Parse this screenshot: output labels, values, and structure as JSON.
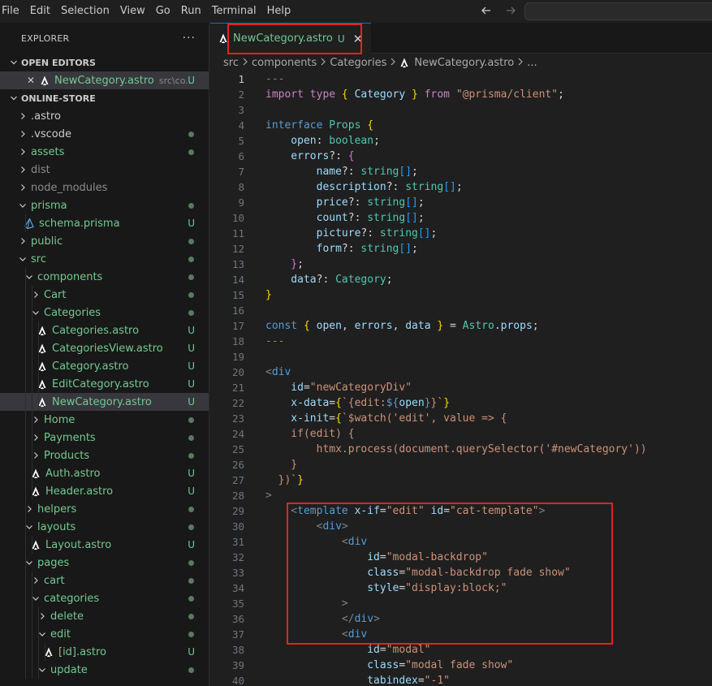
{
  "menu": [
    "File",
    "Edit",
    "Selection",
    "View",
    "Go",
    "Run",
    "Terminal",
    "Help"
  ],
  "explorer": {
    "title": "EXPLORER",
    "more": "···",
    "open_editors_label": "OPEN EDITORS",
    "open_editor": {
      "name": "NewCategory.astro",
      "path": "src\\co...",
      "badge": "U"
    },
    "project_label": "ONLINE-STORE",
    "tree": [
      {
        "label": ".astro",
        "depth": 0,
        "kind": "folder-closed",
        "color": "normal",
        "status": ""
      },
      {
        "label": ".vscode",
        "depth": 0,
        "kind": "folder-closed",
        "color": "normal",
        "status": "dot"
      },
      {
        "label": "assets",
        "depth": 0,
        "kind": "folder-closed",
        "color": "git",
        "status": "dot"
      },
      {
        "label": "dist",
        "depth": 0,
        "kind": "folder-closed",
        "color": "dim",
        "status": ""
      },
      {
        "label": "node_modules",
        "depth": 0,
        "kind": "folder-closed",
        "color": "dim",
        "status": ""
      },
      {
        "label": "prisma",
        "depth": 0,
        "kind": "folder-open",
        "color": "git",
        "status": "dot"
      },
      {
        "label": "schema.prisma",
        "depth": 1,
        "kind": "prisma",
        "color": "git",
        "status": "U"
      },
      {
        "label": "public",
        "depth": 0,
        "kind": "folder-closed",
        "color": "git",
        "status": "dot"
      },
      {
        "label": "src",
        "depth": 0,
        "kind": "folder-open",
        "color": "git",
        "status": "dot"
      },
      {
        "label": "components",
        "depth": 1,
        "kind": "folder-open",
        "color": "git",
        "status": "dot"
      },
      {
        "label": "Cart",
        "depth": 2,
        "kind": "folder-closed",
        "color": "git",
        "status": "dot"
      },
      {
        "label": "Categories",
        "depth": 2,
        "kind": "folder-open",
        "color": "git",
        "status": "dot"
      },
      {
        "label": "Categories.astro",
        "depth": 3,
        "kind": "astro",
        "color": "git",
        "status": "U"
      },
      {
        "label": "CategoriesView.astro",
        "depth": 3,
        "kind": "astro",
        "color": "git",
        "status": "U"
      },
      {
        "label": "Category.astro",
        "depth": 3,
        "kind": "astro",
        "color": "git",
        "status": "U"
      },
      {
        "label": "EditCategory.astro",
        "depth": 3,
        "kind": "astro",
        "color": "git",
        "status": "U"
      },
      {
        "label": "NewCategory.astro",
        "depth": 3,
        "kind": "astro",
        "color": "git",
        "status": "U",
        "selected": true
      },
      {
        "label": "Home",
        "depth": 2,
        "kind": "folder-closed",
        "color": "git",
        "status": "dot"
      },
      {
        "label": "Payments",
        "depth": 2,
        "kind": "folder-closed",
        "color": "git",
        "status": "dot"
      },
      {
        "label": "Products",
        "depth": 2,
        "kind": "folder-closed",
        "color": "git",
        "status": "dot"
      },
      {
        "label": "Auth.astro",
        "depth": 2,
        "kind": "astro",
        "color": "git",
        "status": "U"
      },
      {
        "label": "Header.astro",
        "depth": 2,
        "kind": "astro",
        "color": "git",
        "status": "U"
      },
      {
        "label": "helpers",
        "depth": 1,
        "kind": "folder-closed",
        "color": "git",
        "status": "dot"
      },
      {
        "label": "layouts",
        "depth": 1,
        "kind": "folder-open",
        "color": "git",
        "status": "dot"
      },
      {
        "label": "Layout.astro",
        "depth": 2,
        "kind": "astro",
        "color": "git",
        "status": "U"
      },
      {
        "label": "pages",
        "depth": 1,
        "kind": "folder-open",
        "color": "git",
        "status": "dot"
      },
      {
        "label": "cart",
        "depth": 2,
        "kind": "folder-closed",
        "color": "git",
        "status": "dot"
      },
      {
        "label": "categories",
        "depth": 2,
        "kind": "folder-open",
        "color": "git",
        "status": "dot"
      },
      {
        "label": "delete",
        "depth": 3,
        "kind": "folder-closed",
        "color": "git",
        "status": "dot"
      },
      {
        "label": "edit",
        "depth": 3,
        "kind": "folder-open",
        "color": "git",
        "status": "dot"
      },
      {
        "label": "[id].astro",
        "depth": 4,
        "kind": "astro",
        "color": "git",
        "status": "U"
      },
      {
        "label": "update",
        "depth": 3,
        "kind": "folder-open",
        "color": "git",
        "status": "dot"
      }
    ]
  },
  "tab": {
    "name": "NewCategory.astro",
    "badge": "U"
  },
  "breadcrumb": [
    "src",
    "components",
    "Categories",
    "NewCategory.astro",
    "..."
  ],
  "colors": {
    "keyword": "#569cd6",
    "control": "#c586c0",
    "string": "#ce9178",
    "type": "#4ec9b0",
    "variable": "#9cdcfe",
    "function": "#dcdcaa",
    "text": "#d4d4d4",
    "bracket1": "#ffd700",
    "bracket2": "#da70d6",
    "bracket3": "#179fff",
    "tag": "#808080",
    "comment": "#6a9955",
    "highlight_box": "#e02424",
    "git": "#73c991"
  },
  "code": [
    {
      "n": "1",
      "t": [
        [
          "---",
          "comment"
        ]
      ]
    },
    {
      "n": "2",
      "t": [
        [
          "import type ",
          "control"
        ],
        [
          "{ ",
          "bracket1"
        ],
        [
          "Category",
          "variable"
        ],
        [
          " } ",
          "bracket1"
        ],
        [
          "from ",
          "control"
        ],
        [
          "\"@prisma/client\"",
          "string"
        ],
        [
          ";",
          "text"
        ]
      ]
    },
    {
      "n": "3",
      "t": []
    },
    {
      "n": "4",
      "t": [
        [
          "interface ",
          "keyword"
        ],
        [
          "Props ",
          "type"
        ],
        [
          "{",
          "bracket1"
        ]
      ]
    },
    {
      "n": "5",
      "t": [
        [
          "    open",
          "variable"
        ],
        [
          ": ",
          "text"
        ],
        [
          "boolean",
          "type"
        ],
        [
          ";",
          "text"
        ]
      ]
    },
    {
      "n": "6",
      "t": [
        [
          "    errors",
          "variable"
        ],
        [
          "?: ",
          "text"
        ],
        [
          "{",
          "bracket2"
        ]
      ]
    },
    {
      "n": "7",
      "t": [
        [
          "        name",
          "variable"
        ],
        [
          "?: ",
          "text"
        ],
        [
          "string",
          "type"
        ],
        [
          "[]",
          "bracket3"
        ],
        [
          ";",
          "text"
        ]
      ]
    },
    {
      "n": "8",
      "t": [
        [
          "        description",
          "variable"
        ],
        [
          "?: ",
          "text"
        ],
        [
          "string",
          "type"
        ],
        [
          "[]",
          "bracket3"
        ],
        [
          ";",
          "text"
        ]
      ]
    },
    {
      "n": "9",
      "t": [
        [
          "        price",
          "variable"
        ],
        [
          "?: ",
          "text"
        ],
        [
          "string",
          "type"
        ],
        [
          "[]",
          "bracket3"
        ],
        [
          ";",
          "text"
        ]
      ]
    },
    {
      "n": "10",
      "t": [
        [
          "        count",
          "variable"
        ],
        [
          "?: ",
          "text"
        ],
        [
          "string",
          "type"
        ],
        [
          "[]",
          "bracket3"
        ],
        [
          ";",
          "text"
        ]
      ]
    },
    {
      "n": "11",
      "t": [
        [
          "        picture",
          "variable"
        ],
        [
          "?: ",
          "text"
        ],
        [
          "string",
          "type"
        ],
        [
          "[]",
          "bracket3"
        ],
        [
          ";",
          "text"
        ]
      ]
    },
    {
      "n": "12",
      "t": [
        [
          "        form",
          "variable"
        ],
        [
          "?: ",
          "text"
        ],
        [
          "string",
          "type"
        ],
        [
          "[]",
          "bracket3"
        ],
        [
          ";",
          "text"
        ]
      ]
    },
    {
      "n": "13",
      "t": [
        [
          "    }",
          "bracket2"
        ],
        [
          ";",
          "text"
        ]
      ]
    },
    {
      "n": "14",
      "t": [
        [
          "    data",
          "variable"
        ],
        [
          "?: ",
          "text"
        ],
        [
          "Category",
          "type"
        ],
        [
          ";",
          "text"
        ]
      ]
    },
    {
      "n": "15",
      "t": [
        [
          "}",
          "bracket1"
        ]
      ]
    },
    {
      "n": "16",
      "t": []
    },
    {
      "n": "17",
      "t": [
        [
          "const ",
          "keyword"
        ],
        [
          "{ ",
          "bracket1"
        ],
        [
          "open",
          "variable"
        ],
        [
          ", ",
          "text"
        ],
        [
          "errors",
          "variable"
        ],
        [
          ", ",
          "text"
        ],
        [
          "data",
          "variable"
        ],
        [
          " } ",
          "bracket1"
        ],
        [
          "= ",
          "text"
        ],
        [
          "Astro",
          "type"
        ],
        [
          ".",
          "text"
        ],
        [
          "props",
          "variable"
        ],
        [
          ";",
          "text"
        ]
      ]
    },
    {
      "n": "18",
      "t": [
        [
          "---",
          "comment"
        ]
      ]
    },
    {
      "n": "19",
      "t": []
    },
    {
      "n": "20",
      "t": [
        [
          "<",
          "tag"
        ],
        [
          "div",
          "keyword"
        ]
      ]
    },
    {
      "n": "21",
      "t": [
        [
          "    id",
          "variable"
        ],
        [
          "=",
          "text"
        ],
        [
          "\"newCategoryDiv\"",
          "string"
        ]
      ]
    },
    {
      "n": "22",
      "t": [
        [
          "    x-data",
          "variable"
        ],
        [
          "=",
          "text"
        ],
        [
          "{",
          "bracket1"
        ],
        [
          "`{edit:",
          "string"
        ],
        [
          "${",
          "keyword"
        ],
        [
          "open",
          "variable"
        ],
        [
          "}",
          "keyword"
        ],
        [
          "}`",
          "string"
        ],
        [
          "}",
          "bracket1"
        ]
      ]
    },
    {
      "n": "23",
      "t": [
        [
          "    x-init",
          "variable"
        ],
        [
          "=",
          "text"
        ],
        [
          "{",
          "bracket1"
        ],
        [
          "`$watch('edit', value => {",
          "string"
        ]
      ]
    },
    {
      "n": "24",
      "t": [
        [
          "    if(edit) {",
          "string"
        ]
      ]
    },
    {
      "n": "25",
      "t": [
        [
          "        htmx.process(document.querySelector('#newCategory'))",
          "string"
        ]
      ]
    },
    {
      "n": "26",
      "t": [
        [
          "    }",
          "string"
        ]
      ]
    },
    {
      "n": "27",
      "t": [
        [
          "  })`",
          "string"
        ],
        [
          "}",
          "bracket1"
        ]
      ]
    },
    {
      "n": "28",
      "t": [
        [
          ">",
          "tag"
        ]
      ]
    },
    {
      "n": "29",
      "t": [
        [
          "    <",
          "tag"
        ],
        [
          "template ",
          "keyword"
        ],
        [
          "x-if",
          "variable"
        ],
        [
          "=",
          "text"
        ],
        [
          "\"edit\" ",
          "string"
        ],
        [
          "id",
          "variable"
        ],
        [
          "=",
          "text"
        ],
        [
          "\"cat-template\"",
          "string"
        ],
        [
          ">",
          "tag"
        ]
      ]
    },
    {
      "n": "30",
      "t": [
        [
          "        <",
          "tag"
        ],
        [
          "div",
          "keyword"
        ],
        [
          ">",
          "tag"
        ]
      ]
    },
    {
      "n": "31",
      "t": [
        [
          "            <",
          "tag"
        ],
        [
          "div",
          "keyword"
        ]
      ]
    },
    {
      "n": "32",
      "t": [
        [
          "                id",
          "variable"
        ],
        [
          "=",
          "text"
        ],
        [
          "\"modal-backdrop\"",
          "string"
        ]
      ]
    },
    {
      "n": "33",
      "t": [
        [
          "                class",
          "variable"
        ],
        [
          "=",
          "text"
        ],
        [
          "\"modal-backdrop fade show\"",
          "string"
        ]
      ]
    },
    {
      "n": "34",
      "t": [
        [
          "                style",
          "variable"
        ],
        [
          "=",
          "text"
        ],
        [
          "\"display:block;\"",
          "string"
        ]
      ]
    },
    {
      "n": "35",
      "t": [
        [
          "            >",
          "tag"
        ]
      ]
    },
    {
      "n": "36",
      "t": [
        [
          "            </",
          "tag"
        ],
        [
          "div",
          "keyword"
        ],
        [
          ">",
          "tag"
        ]
      ]
    },
    {
      "n": "37",
      "t": [
        [
          "            <",
          "tag"
        ],
        [
          "div",
          "keyword"
        ]
      ]
    },
    {
      "n": "38",
      "t": [
        [
          "                id",
          "variable"
        ],
        [
          "=",
          "text"
        ],
        [
          "\"modal\"",
          "string"
        ]
      ]
    },
    {
      "n": "39",
      "t": [
        [
          "                class",
          "variable"
        ],
        [
          "=",
          "text"
        ],
        [
          "\"modal fade show\"",
          "string"
        ]
      ]
    },
    {
      "n": "40",
      "t": [
        [
          "                tabindex",
          "variable"
        ],
        [
          "=",
          "text"
        ],
        [
          "\"-1\"",
          "string"
        ]
      ]
    }
  ]
}
